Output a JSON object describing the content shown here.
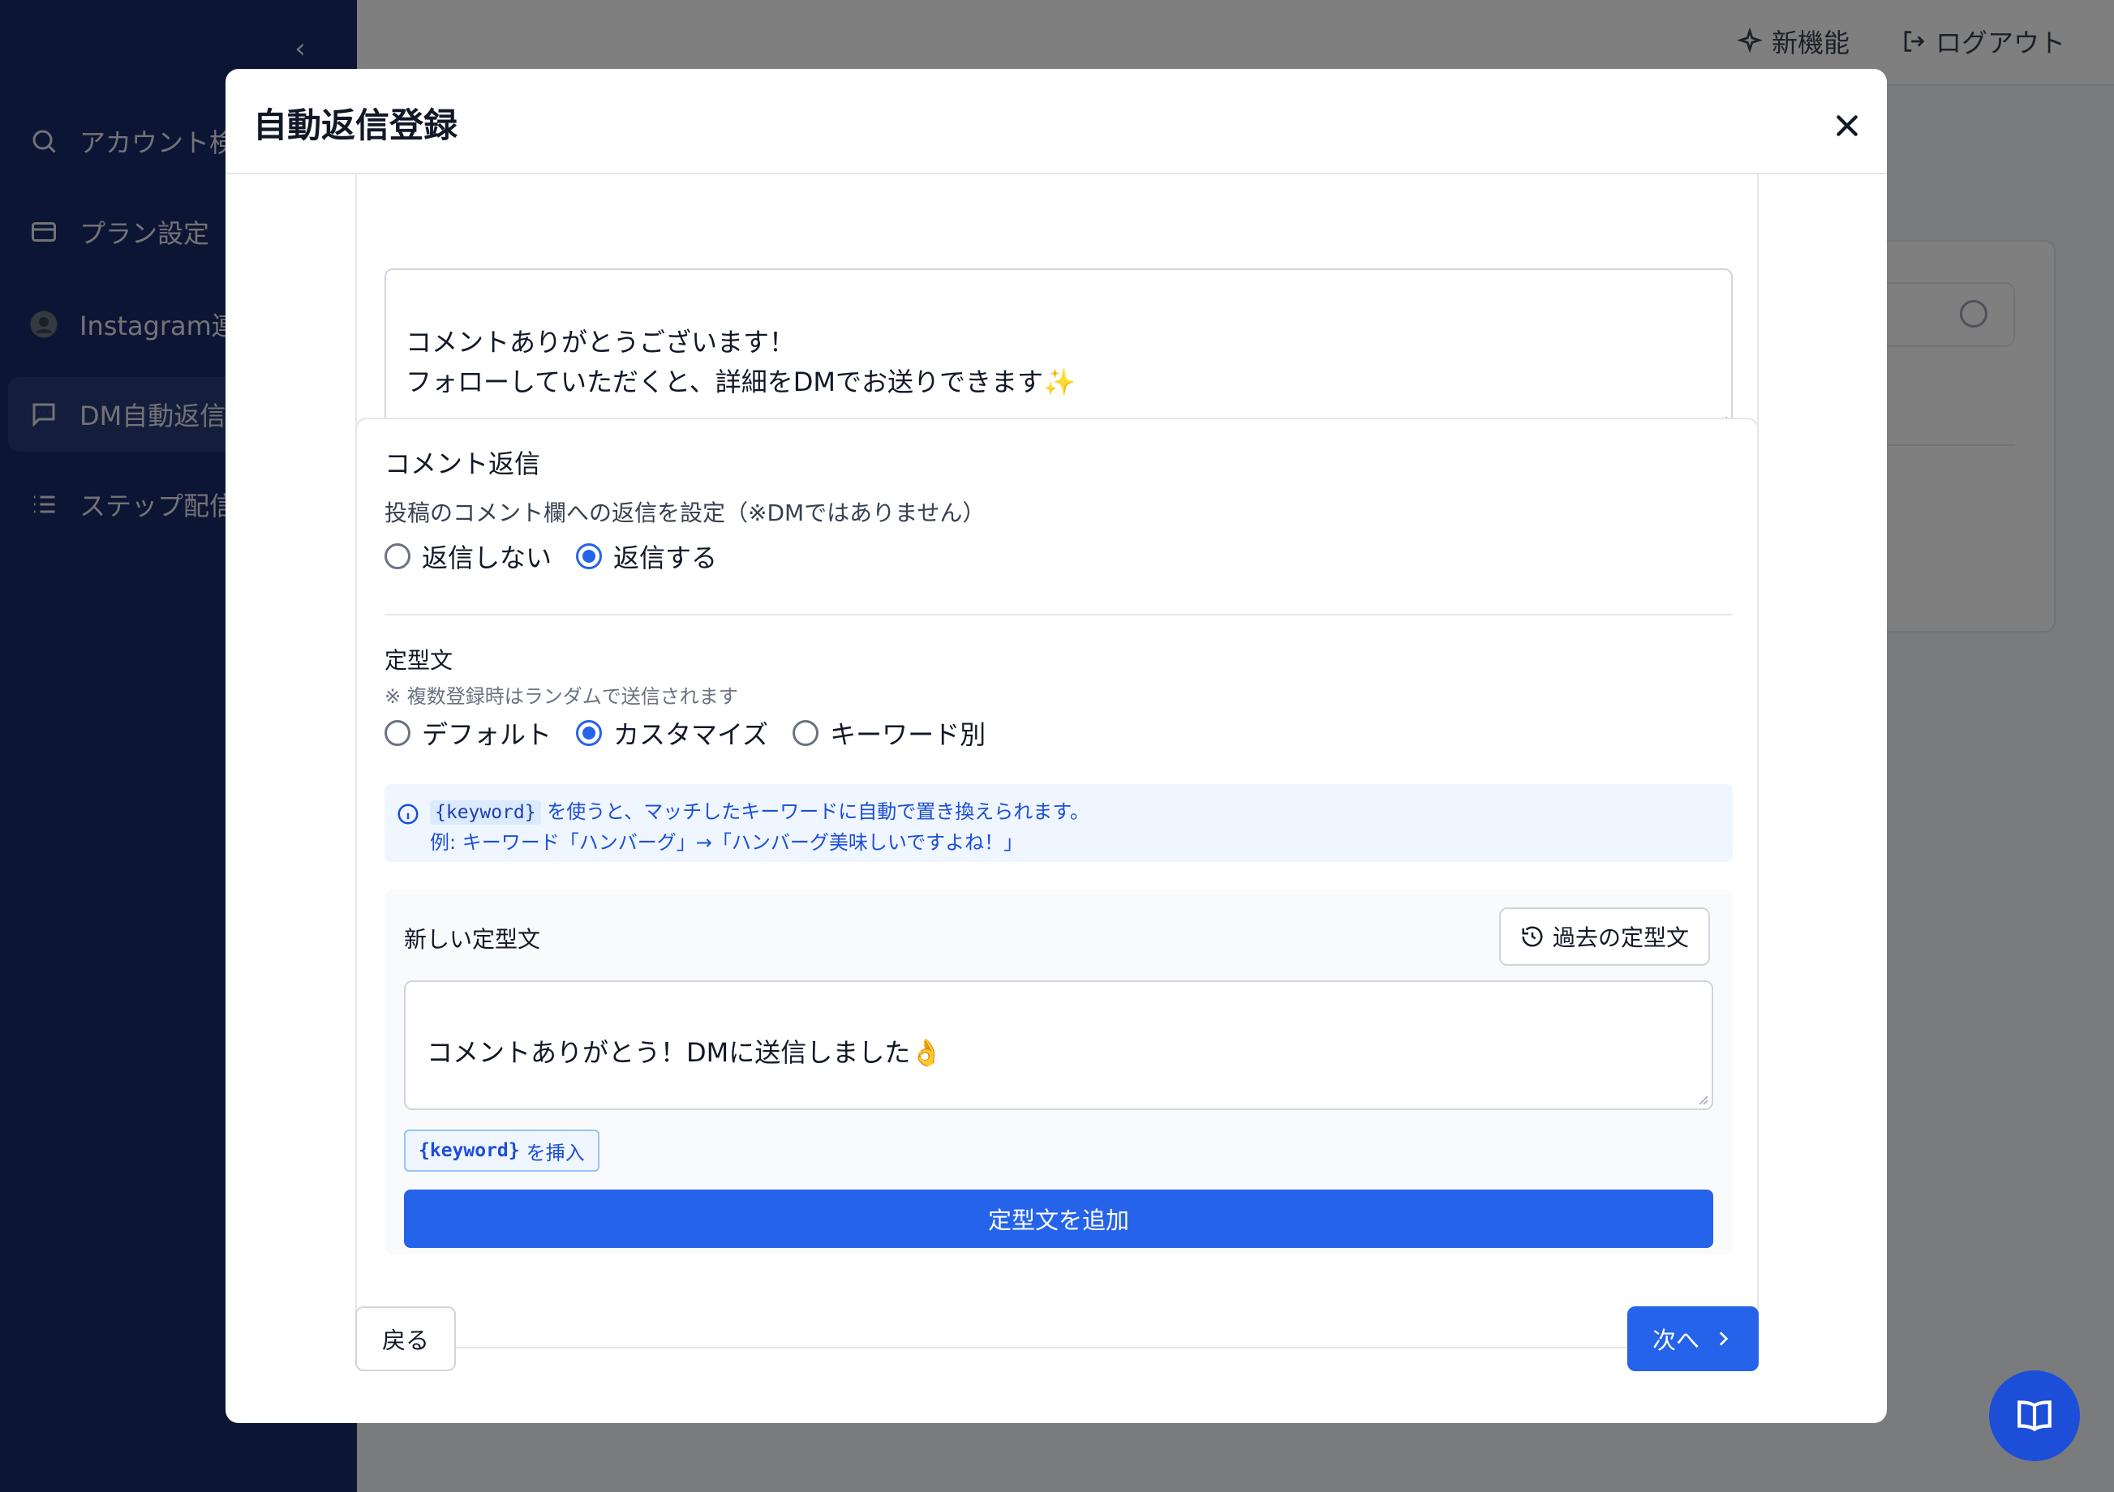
{
  "topbar": {
    "new_features": "新機能",
    "logout": "ログアウト"
  },
  "sidebar": {
    "items": [
      {
        "label": "アカウント検索",
        "icon": "search-icon"
      },
      {
        "label": "プラン設定",
        "icon": "credit-card-icon"
      },
      {
        "label": "Instagram連携",
        "icon": "avatar-icon"
      },
      {
        "label": "DM自動返信",
        "icon": "chat-icon",
        "active": true
      },
      {
        "label": "ステップ配信",
        "icon": "list-icon"
      }
    ]
  },
  "modal": {
    "title": "自動返信登録",
    "message_text": "コメントありがとうございます！\nフォローしていただくと、詳細をDMでお送りできます✨",
    "comment_reply": {
      "title": "コメント返信",
      "description": "投稿のコメント欄への返信を設定（※DMではありません）",
      "options": [
        "返信しない",
        "返信する"
      ],
      "selected": "返信する"
    },
    "template": {
      "title": "定型文",
      "note": "※ 複数登録時はランダムで送信されます",
      "options": [
        "デフォルト",
        "カスタマイズ",
        "キーワード別"
      ],
      "selected": "カスタマイズ"
    },
    "info": {
      "keyword_code": "{keyword}",
      "line1_rest": "を使うと、マッチしたキーワードに自動で置き換えられます。",
      "line2": "例: キーワード「ハンバーグ」→「ハンバーグ美味しいですよね！」"
    },
    "new_template": {
      "label": "新しい定型文",
      "past_button": "過去の定型文",
      "value": "コメントありがとう！DMに送信しました👌",
      "insert_keyword": "{keyword}",
      "insert_suffix": "を挿入",
      "add_button": "定型文を追加"
    },
    "footer": {
      "back": "戻る",
      "next": "次へ"
    }
  },
  "colors": {
    "primary": "#2563eb",
    "sidebar": "#1a2a6a",
    "info_bg": "#eff6ff"
  }
}
